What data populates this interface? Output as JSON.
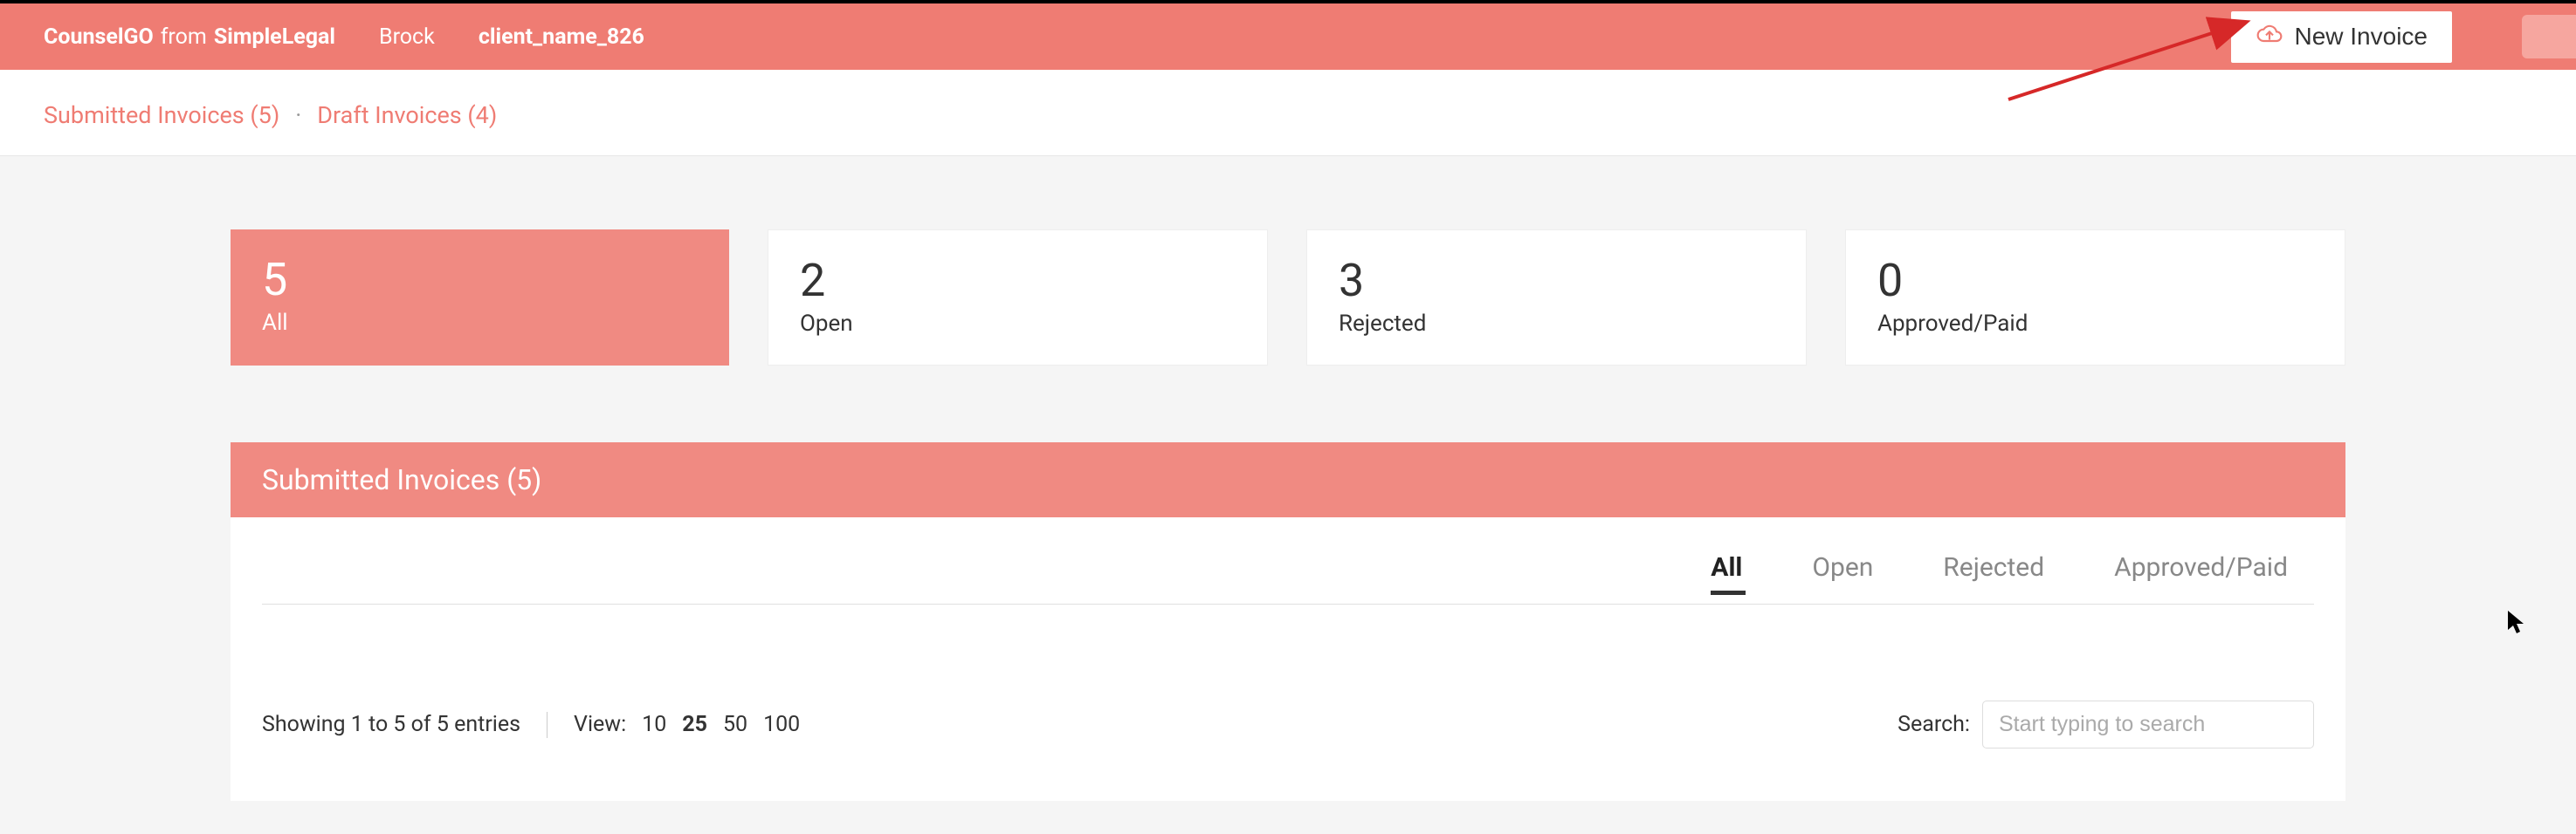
{
  "header": {
    "brand_main": "CounselGO",
    "brand_from": "from",
    "brand_sub": "SimpleLegal",
    "user": "Brock",
    "client": "client_name_826",
    "new_invoice_label": "New Invoice"
  },
  "subheader": {
    "submitted_link": "Submitted Invoices (5)",
    "separator": "·",
    "draft_link": "Draft Invoices (4)"
  },
  "stats": [
    {
      "count": "5",
      "label": "All",
      "active": true
    },
    {
      "count": "2",
      "label": "Open",
      "active": false
    },
    {
      "count": "3",
      "label": "Rejected",
      "active": false
    },
    {
      "count": "0",
      "label": "Approved/Paid",
      "active": false
    }
  ],
  "panel": {
    "title": "Submitted Invoices (5)",
    "filter_tabs": [
      {
        "label": "All",
        "active": true
      },
      {
        "label": "Open",
        "active": false
      },
      {
        "label": "Rejected",
        "active": false
      },
      {
        "label": "Approved/Paid",
        "active": false
      }
    ],
    "showing_text": "Showing 1 to 5 of 5 entries",
    "view_label": "View:",
    "view_options": [
      {
        "value": "10",
        "active": false
      },
      {
        "value": "25",
        "active": true
      },
      {
        "value": "50",
        "active": false
      },
      {
        "value": "100",
        "active": false
      }
    ],
    "search_label": "Search:",
    "search_placeholder": "Start typing to search"
  }
}
